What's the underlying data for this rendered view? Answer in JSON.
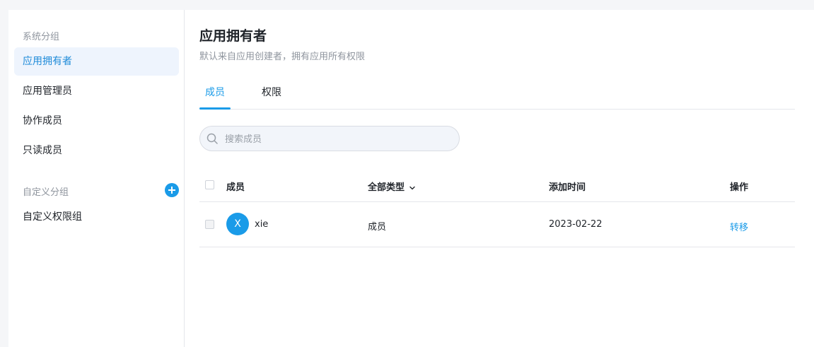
{
  "sidebar": {
    "system_group_title": "系统分组",
    "system_items": [
      {
        "label": "应用拥有者"
      },
      {
        "label": "应用管理员"
      },
      {
        "label": "协作成员"
      },
      {
        "label": "只读成员"
      }
    ],
    "custom_group_title": "自定义分组",
    "custom_items": [
      {
        "label": "自定义权限组"
      }
    ]
  },
  "header": {
    "title": "应用拥有者",
    "subtitle": "默认来自应用创建者，拥有应用所有权限"
  },
  "tabs": [
    {
      "label": "成员"
    },
    {
      "label": "权限"
    }
  ],
  "search": {
    "placeholder": "搜索成员",
    "value": ""
  },
  "table": {
    "columns": [
      "成员",
      "全部类型",
      "添加时间",
      "操作"
    ],
    "rows": [
      {
        "avatar_initial": "X",
        "name": "xie",
        "type": "成员",
        "added": "2023-02-22",
        "action": "转移"
      }
    ]
  },
  "colors": {
    "accent": "#1a9be8",
    "active_bg": "#eef4fd"
  },
  "icons": [
    "add-icon",
    "search-icon",
    "chevron-down-icon"
  ]
}
